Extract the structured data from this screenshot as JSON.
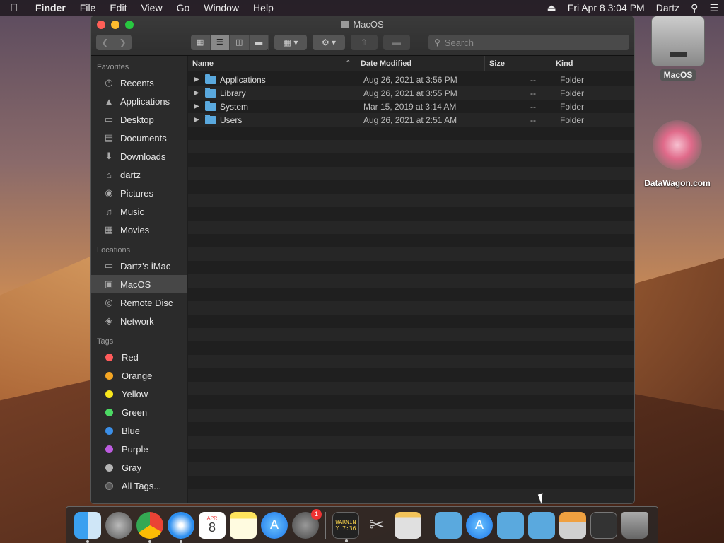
{
  "menubar": {
    "app_name": "Finder",
    "menus": [
      "File",
      "Edit",
      "View",
      "Go",
      "Window",
      "Help"
    ],
    "clock": "Fri Apr 8  3:04 PM",
    "user": "Dartz"
  },
  "desktop": {
    "drive_label": "MacOS",
    "watermark_label": "DataWagon.com"
  },
  "window": {
    "title": "MacOS",
    "search_placeholder": "Search"
  },
  "sidebar": {
    "favorites_header": "Favorites",
    "favorites": [
      {
        "label": "Recents",
        "icon": "clock-icon"
      },
      {
        "label": "Applications",
        "icon": "applications-icon"
      },
      {
        "label": "Desktop",
        "icon": "desktop-icon"
      },
      {
        "label": "Documents",
        "icon": "documents-icon"
      },
      {
        "label": "Downloads",
        "icon": "downloads-icon"
      },
      {
        "label": "dartz",
        "icon": "home-icon"
      },
      {
        "label": "Pictures",
        "icon": "camera-icon"
      },
      {
        "label": "Music",
        "icon": "music-icon"
      },
      {
        "label": "Movies",
        "icon": "film-icon"
      }
    ],
    "locations_header": "Locations",
    "locations": [
      {
        "label": "Dartz’s iMac",
        "icon": "imac-icon"
      },
      {
        "label": "MacOS",
        "icon": "disk-icon"
      },
      {
        "label": "Remote Disc",
        "icon": "disc-icon"
      },
      {
        "label": "Network",
        "icon": "globe-icon"
      }
    ],
    "tags_header": "Tags",
    "tags": [
      {
        "label": "Red",
        "color": "#ff5b5b"
      },
      {
        "label": "Orange",
        "color": "#f5a623"
      },
      {
        "label": "Yellow",
        "color": "#f8e71c"
      },
      {
        "label": "Green",
        "color": "#4cd964"
      },
      {
        "label": "Blue",
        "color": "#3b8fe8"
      },
      {
        "label": "Purple",
        "color": "#bd5ce0"
      },
      {
        "label": "Gray",
        "color": "#b5b5b5"
      },
      {
        "label": "All Tags...",
        "color": "#555555"
      }
    ]
  },
  "list": {
    "columns": {
      "name": "Name",
      "date": "Date Modified",
      "size": "Size",
      "kind": "Kind"
    },
    "rows": [
      {
        "name": "Applications",
        "date": "Aug 26, 2021 at 3:56 PM",
        "size": "--",
        "kind": "Folder"
      },
      {
        "name": "Library",
        "date": "Aug 26, 2021 at 3:55 PM",
        "size": "--",
        "kind": "Folder"
      },
      {
        "name": "System",
        "date": "Mar 15, 2019 at 3:14 AM",
        "size": "--",
        "kind": "Folder"
      },
      {
        "name": "Users",
        "date": "Aug 26, 2021 at 2:51 AM",
        "size": "--",
        "kind": "Folder"
      }
    ]
  },
  "dock": {
    "calendar_month": "APR",
    "calendar_day": "8",
    "prefs_badge": "1",
    "console_text": "WARNIN\nY 7:36"
  }
}
